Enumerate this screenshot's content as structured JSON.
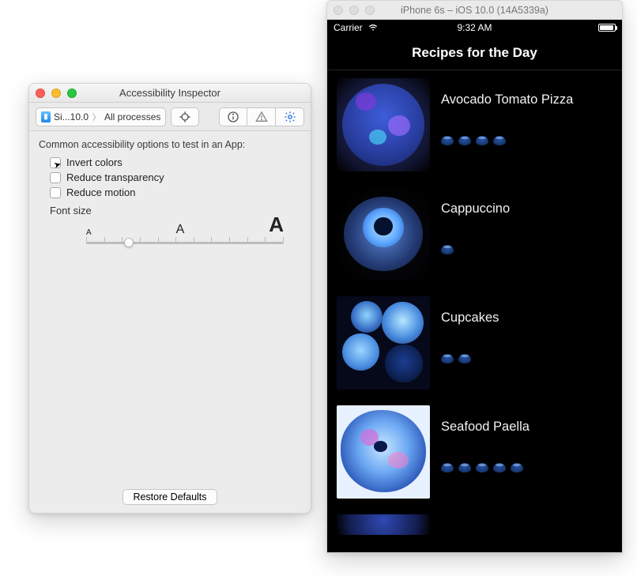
{
  "inspector": {
    "window_title": "Accessibility Inspector",
    "target_label": "Si...10.0",
    "process_label": "All processes",
    "body_heading": "Common accessibility options to test in an App:",
    "options": {
      "invert_colors": "Invert colors",
      "reduce_transparency": "Reduce transparency",
      "reduce_motion": "Reduce motion"
    },
    "font_size_label": "Font size",
    "slider": {
      "small": "A",
      "mid": "A",
      "large": "A"
    },
    "restore_button": "Restore Defaults"
  },
  "simulator": {
    "window_title": "iPhone 6s – iOS 10.0 (14A5339a)",
    "status": {
      "carrier": "Carrier",
      "time": "9:32 AM"
    },
    "nav_title": "Recipes for the Day",
    "recipes": [
      {
        "title": "Avocado Tomato Pizza",
        "rating": 4
      },
      {
        "title": "Cappuccino",
        "rating": 1
      },
      {
        "title": "Cupcakes",
        "rating": 2
      },
      {
        "title": "Seafood Paella",
        "rating": 5
      }
    ]
  }
}
